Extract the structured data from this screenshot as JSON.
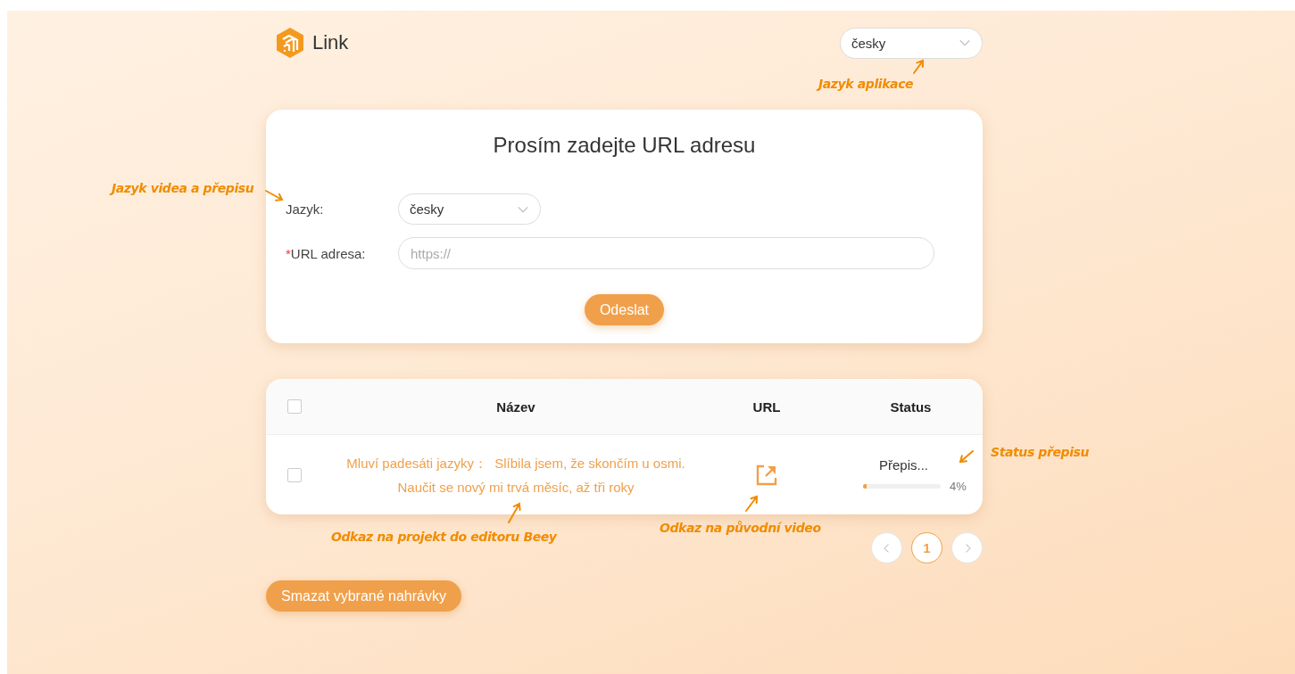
{
  "header": {
    "logo_text": "Link",
    "app_language": "česky"
  },
  "form": {
    "title": "Prosím zadejte URL adresu",
    "language_label": "Jazyk:",
    "language_value": "česky",
    "url_required_mark": "*",
    "url_label": "URL adresa:",
    "url_placeholder": "https://",
    "submit": "Odeslat"
  },
  "table": {
    "select_all_checked": false,
    "columns": [
      "Název",
      "URL",
      "Status"
    ],
    "rows": [
      {
        "checked": false,
        "name": "Mluví padesáti jazyky：  Slíbila jsem, že skončím u osmi. Naučit se nový mi trvá měsíc, až tři roky",
        "status": "Přepis...",
        "level": 0.04,
        "progress_text": "4%"
      }
    ]
  },
  "pagination": {
    "pages": [
      {
        "label": "1",
        "selected": true
      }
    ]
  },
  "delete_button": "Smazat vybrané nahrávky",
  "annotations": [
    {
      "text": "Jazyk aplikace"
    },
    {
      "text": "Jazyk videa a přepisu"
    },
    {
      "text": "Status přepisu"
    },
    {
      "text": "Odkaz na projekt do editoru Beey"
    },
    {
      "text": "Odkaz na původní video"
    }
  ]
}
